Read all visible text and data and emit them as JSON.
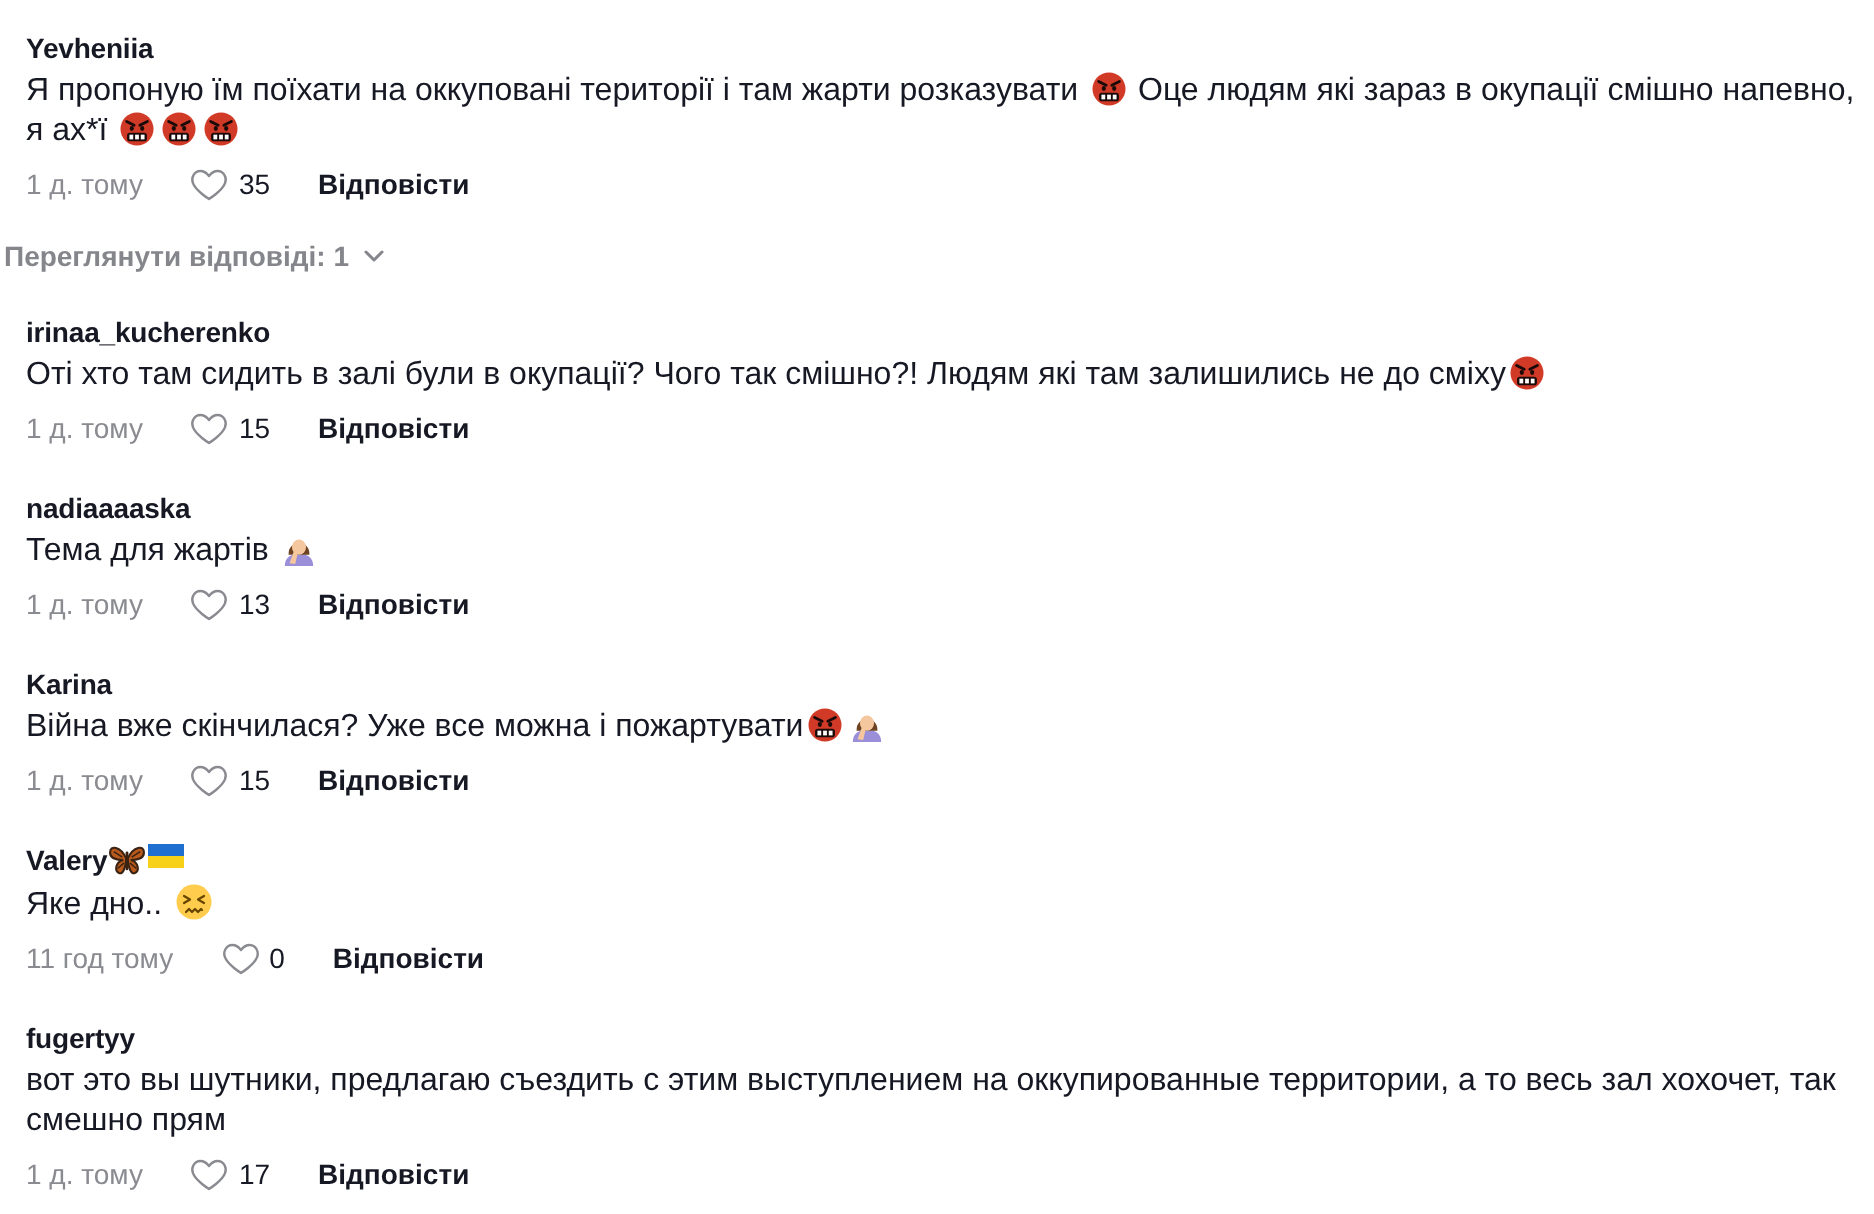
{
  "comments": [
    {
      "author": [
        {
          "kind": "text",
          "text": "Yevheniia"
        }
      ],
      "body": [
        {
          "kind": "text",
          "text": "Я пропоную їм поїхати на оккуповані території і там жарти розказувати "
        },
        {
          "kind": "angry"
        },
        {
          "kind": "text",
          "text": " Оце людям які зараз в окупації смішно напевно, "
        },
        {
          "kind": "text",
          "text": "я ах*ї "
        },
        {
          "kind": "angry"
        },
        {
          "kind": "angry"
        },
        {
          "kind": "angry"
        }
      ],
      "time": "1 д. тому",
      "likes": "35",
      "reply": "Відповісти",
      "view_replies": "Переглянути відповіді: 1"
    },
    {
      "author": [
        {
          "kind": "text",
          "text": "irinaa_kucherenko"
        }
      ],
      "body": [
        {
          "kind": "text",
          "text": "Оті хто там сидить в залі були в окупації? Чого так смішно?! Людям які там залишились не до сміху"
        },
        {
          "kind": "angry"
        }
      ],
      "time": "1 д. тому",
      "likes": "15",
      "reply": "Відповісти"
    },
    {
      "author": [
        {
          "kind": "text",
          "text": "nadiaaaaska"
        }
      ],
      "body": [
        {
          "kind": "text",
          "text": "Тема для жартів "
        },
        {
          "kind": "facepalm"
        }
      ],
      "time": "1 д. тому",
      "likes": "13",
      "reply": "Відповісти"
    },
    {
      "author": [
        {
          "kind": "text",
          "text": "Karina"
        }
      ],
      "body": [
        {
          "kind": "text",
          "text": "Війна вже скінчилася? Уже все можна і пожартувати"
        },
        {
          "kind": "angry"
        },
        {
          "kind": "facepalm"
        }
      ],
      "time": "1 д. тому",
      "likes": "15",
      "reply": "Відповісти"
    },
    {
      "author": [
        {
          "kind": "text",
          "text": "Valery"
        },
        {
          "kind": "butterfly"
        },
        {
          "kind": "flag"
        }
      ],
      "body": [
        {
          "kind": "text",
          "text": "Яке дно.. "
        },
        {
          "kind": "confounded"
        }
      ],
      "time": "11 год тому",
      "likes": "0",
      "reply": "Відповісти"
    },
    {
      "author": [
        {
          "kind": "text",
          "text": "fugertyy"
        }
      ],
      "body": [
        {
          "kind": "text",
          "text": "вот это вы шутники, предлагаю съездить с этим выступлением на оккупированные территории, а то весь зал хохочет, так смешно прям"
        }
      ],
      "time": "1 д. тому",
      "likes": "17",
      "reply": "Відповісти"
    }
  ]
}
